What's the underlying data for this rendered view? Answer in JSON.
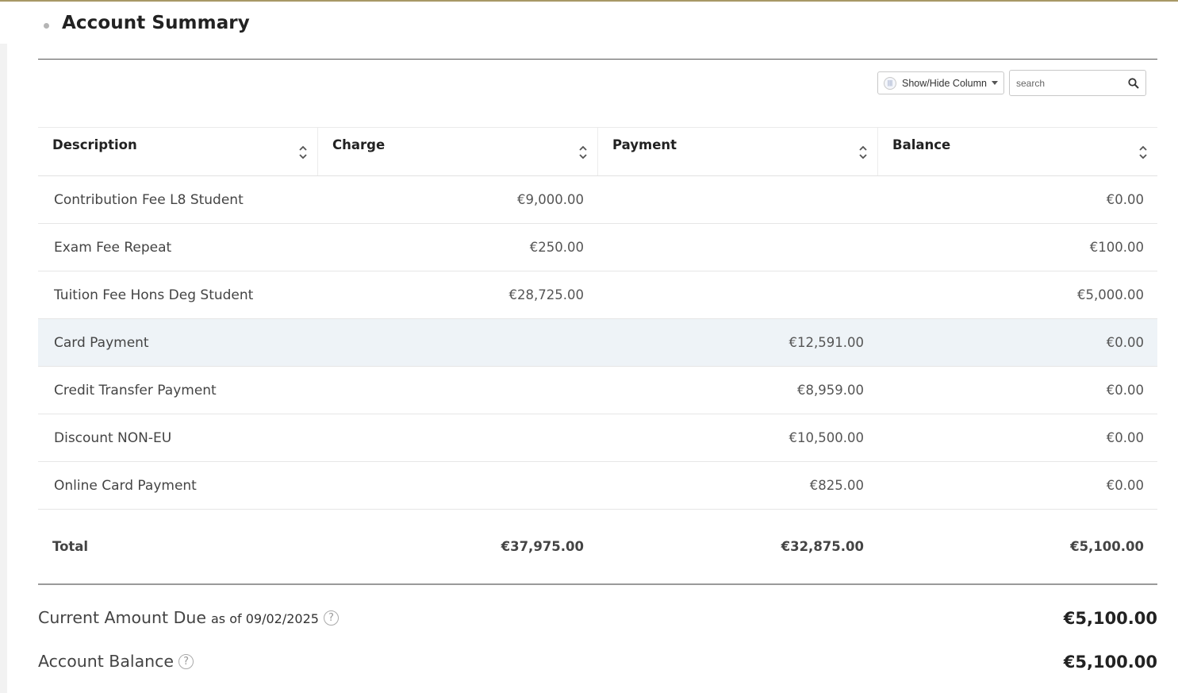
{
  "header": {
    "title": "Account Summary"
  },
  "toolbar": {
    "showhide_label": "Show/Hide Column",
    "search_placeholder": "search"
  },
  "table": {
    "columns": [
      {
        "label": "Description"
      },
      {
        "label": "Charge"
      },
      {
        "label": "Payment"
      },
      {
        "label": "Balance"
      }
    ],
    "rows": [
      {
        "description": "Contribution Fee L8 Student",
        "charge": "€9,000.00",
        "payment": "",
        "balance": "€0.00"
      },
      {
        "description": "Exam Fee Repeat",
        "charge": "€250.00",
        "payment": "",
        "balance": "€100.00"
      },
      {
        "description": "Tuition Fee Hons Deg Student",
        "charge": "€28,725.00",
        "payment": "",
        "balance": "€5,000.00"
      },
      {
        "description": "Card Payment",
        "charge": "",
        "payment": "€12,591.00",
        "balance": "€0.00"
      },
      {
        "description": "Credit Transfer Payment",
        "charge": "",
        "payment": "€8,959.00",
        "balance": "€0.00"
      },
      {
        "description": "Discount NON-EU",
        "charge": "",
        "payment": "€10,500.00",
        "balance": "€0.00"
      },
      {
        "description": "Online Card Payment",
        "charge": "",
        "payment": "€825.00",
        "balance": "€0.00"
      }
    ],
    "total": {
      "label": "Total",
      "charge": "€37,975.00",
      "payment": "€32,875.00",
      "balance": "€5,100.00"
    }
  },
  "summary": {
    "current_due_label": "Current Amount Due",
    "current_due_asof": "as of 09/02/2025",
    "current_due_value": "€5,100.00",
    "account_balance_label": "Account Balance",
    "account_balance_value": "€5,100.00",
    "help_glyph": "?"
  },
  "colors": {
    "accent_rule": "#a89866",
    "highlight_row": "#eef3f7"
  }
}
